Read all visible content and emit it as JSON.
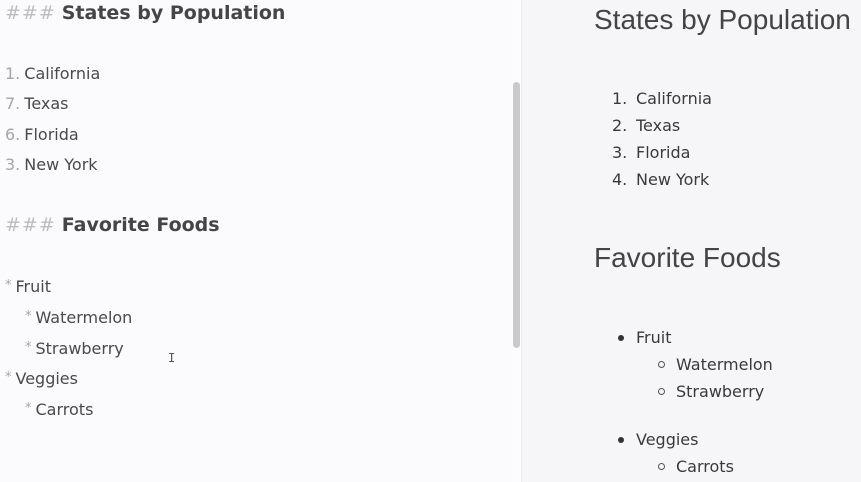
{
  "editor": {
    "hash_marks": "###",
    "heading1": "States by Population",
    "ordered": [
      {
        "num": "1.",
        "text": "California"
      },
      {
        "num": "7.",
        "text": "Texas"
      },
      {
        "num": "6.",
        "text": "Florida"
      },
      {
        "num": "3.",
        "text": "New York"
      }
    ],
    "heading2": "Favorite Foods",
    "bullet": "*",
    "foods": {
      "fruit": "Fruit",
      "watermelon": "Watermelon",
      "strawberry": "Strawberry",
      "veggies": "Veggies",
      "carrots": "Carrots"
    },
    "cursor_glyph": "I"
  },
  "preview": {
    "heading1": "States by Population",
    "ordered": [
      {
        "num": "1.",
        "text": "California"
      },
      {
        "num": "2.",
        "text": "Texas"
      },
      {
        "num": "3.",
        "text": "Florida"
      },
      {
        "num": "4.",
        "text": "New York"
      }
    ],
    "heading2": "Favorite Foods",
    "foods": {
      "fruit": "Fruit",
      "watermelon": "Watermelon",
      "strawberry": "Strawberry",
      "veggies": "Veggies",
      "carrots": "Carrots"
    },
    "chevron_icon": "chevron-right-icon"
  }
}
